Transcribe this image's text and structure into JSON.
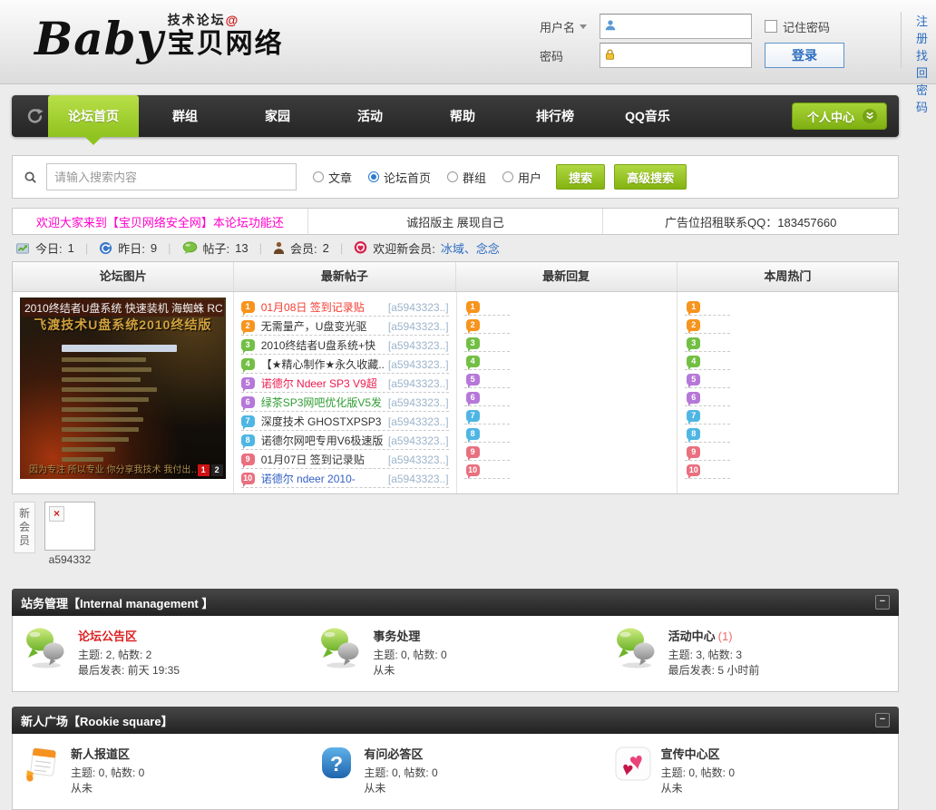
{
  "colors": {
    "accent_green": "#8fc31f",
    "nav_dark": "#2d2d2d",
    "notice_magenta": "#ff00cc",
    "link_blue": "#2b6dc0",
    "author_blue": "#9db4ca"
  },
  "header": {
    "logo_baby": "Baby",
    "logo_sub": "技术论坛",
    "logo_at": "@",
    "logo_main": "宝贝网络",
    "login": {
      "username_label": "用户名",
      "password_label": "密码",
      "remember_label": "记住密码",
      "login_button": "登录",
      "register_link": "注册",
      "forgot_link": "找回密码"
    }
  },
  "nav": {
    "items": [
      {
        "label": "论坛首页",
        "active": true
      },
      {
        "label": "群组",
        "active": false
      },
      {
        "label": "家园",
        "active": false
      },
      {
        "label": "活动",
        "active": false
      },
      {
        "label": "帮助",
        "active": false
      },
      {
        "label": "排行榜",
        "active": false
      },
      {
        "label": "QQ音乐",
        "active": false
      }
    ],
    "user_center_label": "个人中心"
  },
  "search": {
    "placeholder": "请输入搜索内容",
    "options": [
      {
        "label": "文章",
        "checked": false
      },
      {
        "label": "论坛首页",
        "checked": true
      },
      {
        "label": "群组",
        "checked": false
      },
      {
        "label": "用户",
        "checked": false
      }
    ],
    "search_button": "搜索",
    "advanced_button": "高级搜索"
  },
  "announcements": [
    {
      "text": "欢迎大家来到【宝贝网络安全网】本论坛功能还",
      "color": "#ff00cc"
    },
    {
      "text": "诚招版主 展现自己",
      "color": "#333333"
    },
    {
      "text": "广告位招租联系QQ：183457660",
      "color": "#333333"
    }
  ],
  "stats": [
    {
      "icon": "chart-icon",
      "label": "今日:",
      "value": "1",
      "link": false
    },
    {
      "icon": "refresh-icon",
      "label": "昨日:",
      "value": "9",
      "link": false
    },
    {
      "icon": "bubble-icon",
      "label": "帖子:",
      "value": "13",
      "link": false
    },
    {
      "icon": "member-icon",
      "label": "会员:",
      "value": "2",
      "link": false
    },
    {
      "icon": "pin-icon",
      "label": "欢迎新会员:",
      "value": "冰域、念念",
      "link": true
    }
  ],
  "board": {
    "headers": [
      "论坛图片",
      "最新帖子",
      "最新回复",
      "本周热门"
    ],
    "slide": {
      "top_caption": "2010终结者U盘系统 快速装机 海蜘蛛 RC",
      "gold_title": "飞渡技术U盘系统2010终结版",
      "bottom_caption": "因为专注 所以专业 你分享我技术 我付出…",
      "pager_current": "1",
      "pager_next": "2"
    },
    "badge_colors": [
      "#F7941E",
      "#F7941E",
      "#72BF44",
      "#72BF44",
      "#B678D8",
      "#B678D8",
      "#4FB6E3",
      "#4FB6E3",
      "#E9707F",
      "#E9707F"
    ],
    "latest_posts": [
      {
        "num": "1",
        "title": "01月08日 签到记录贴",
        "title_color": "#f43b2f",
        "author": "[a5943323..]"
      },
      {
        "num": "2",
        "title": "无需量产，U盘变光驱",
        "title_color": "#333333",
        "author": "[a5943323..]"
      },
      {
        "num": "3",
        "title": "2010终结者U盘系统+快",
        "title_color": "#333333",
        "author": "[a5943323..]"
      },
      {
        "num": "4",
        "title": "【★精心制作★永久收藏..",
        "title_color": "#333333",
        "author": "[a5943323..]"
      },
      {
        "num": "5",
        "title": "诺德尔 Ndeer SP3 V9超",
        "title_color": "#ee1b4e",
        "author": "[a5943323..]"
      },
      {
        "num": "6",
        "title": "绿茶SP3网吧优化版V5发",
        "title_color": "#2f9d32",
        "author": "[a5943323..]"
      },
      {
        "num": "7",
        "title": "深度技术 GHOSTXPSP3",
        "title_color": "#333333",
        "author": "[a5943323..]"
      },
      {
        "num": "8",
        "title": "诺德尔网吧专用V6极速版",
        "title_color": "#333333",
        "author": "[a5943323..]"
      },
      {
        "num": "9",
        "title": "01月07日 签到记录贴",
        "title_color": "#333333",
        "author": "[a5943323..]"
      },
      {
        "num": "10",
        "title": "诺德尔 ndeer 2010-",
        "title_color": "#3360c4",
        "author": "[a5943323..]"
      }
    ],
    "latest_replies_nums": [
      "1",
      "2",
      "3",
      "4",
      "5",
      "6",
      "7",
      "8",
      "9",
      "10"
    ],
    "week_hot_nums": [
      "1",
      "2",
      "3",
      "4",
      "5",
      "6",
      "7",
      "8",
      "9",
      "10"
    ]
  },
  "new_member": {
    "group_label": "新会员",
    "name": "a594332"
  },
  "sections": [
    {
      "title": "站务管理【Internal management 】",
      "collapse_label": "−",
      "forums": [
        {
          "icon": "forum-bubbles-icon",
          "title": "论坛公告区",
          "title_color": "#dd2222",
          "new_count": "",
          "stats": "主题: 2, 帖数: 2",
          "last": "最后发表: 前天 19:35"
        },
        {
          "icon": "forum-bubbles-icon",
          "title": "事务处理",
          "title_color": "#333333",
          "new_count": "",
          "stats": "主题: 0, 帖数: 0",
          "last": "从未"
        },
        {
          "icon": "forum-bubbles-icon",
          "title": "活动中心",
          "title_color": "#333333",
          "new_count": "(1)",
          "stats": "主题: 3, 帖数: 3",
          "last": "最后发表: 5 小时前"
        }
      ]
    },
    {
      "title": "新人广场【Rookie square】",
      "collapse_label": "−",
      "forums": [
        {
          "icon": "newbie-icon",
          "title": "新人报道区",
          "title_color": "#333333",
          "new_count": "",
          "stats": "主题: 0, 帖数: 0",
          "last": "从未"
        },
        {
          "icon": "question-icon",
          "title": "有问必答区",
          "title_color": "#333333",
          "new_count": "",
          "stats": "主题: 0, 帖数: 0",
          "last": "从未"
        },
        {
          "icon": "hearts-icon",
          "title": "宣传中心区",
          "title_color": "#333333",
          "new_count": "",
          "stats": "主题: 0, 帖数: 0",
          "last": "从未"
        }
      ]
    }
  ]
}
